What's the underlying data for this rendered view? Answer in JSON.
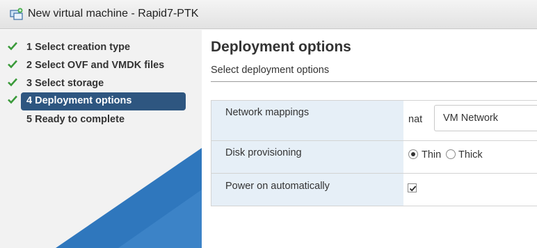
{
  "window": {
    "title": "New virtual machine - Rapid7-PTK",
    "icon": "virtual-machine-icon"
  },
  "sidebar": {
    "steps": [
      {
        "label": "1 Select creation type",
        "completed": true,
        "active": false
      },
      {
        "label": "2 Select OVF and VMDK files",
        "completed": true,
        "active": false
      },
      {
        "label": "3 Select storage",
        "completed": true,
        "active": false
      },
      {
        "label": "4 Deployment options",
        "completed": true,
        "active": true
      },
      {
        "label": "5 Ready to complete",
        "completed": false,
        "active": false
      }
    ],
    "check_color": "#3a9a3a",
    "active_color": "#2e5680",
    "wedge_color": "#2f77bd"
  },
  "main": {
    "heading": "Deployment options",
    "subheading": "Select deployment options",
    "network_mappings": {
      "label": "Network mappings",
      "source": "nat",
      "value": "VM Network"
    },
    "disk_provisioning": {
      "label": "Disk provisioning",
      "options": [
        "Thin",
        "Thick"
      ],
      "selected": "Thin"
    },
    "power_on": {
      "label": "Power on automatically",
      "checked": true
    }
  }
}
